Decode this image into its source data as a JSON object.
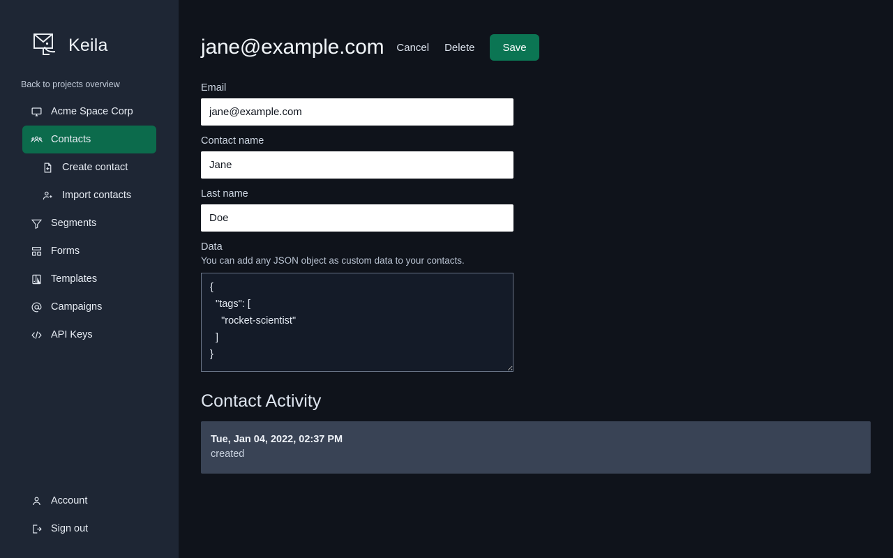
{
  "brand": {
    "name": "Keila",
    "logo_icon": "envelope-rocket-logo"
  },
  "sidebar": {
    "back_link": "Back to projects overview",
    "items": [
      {
        "label": "Acme Space Corp",
        "icon": "monitor-icon",
        "active": false,
        "sub": false
      },
      {
        "label": "Contacts",
        "icon": "users-group-icon",
        "active": true,
        "sub": false
      },
      {
        "label": "Create contact",
        "icon": "document-plus-icon",
        "active": false,
        "sub": true
      },
      {
        "label": "Import contacts",
        "icon": "user-plus-icon",
        "active": false,
        "sub": true
      },
      {
        "label": "Segments",
        "icon": "funnel-icon",
        "active": false,
        "sub": false
      },
      {
        "label": "Forms",
        "icon": "layout-rows-icon",
        "active": false,
        "sub": false
      },
      {
        "label": "Templates",
        "icon": "template-document-icon",
        "active": false,
        "sub": false
      },
      {
        "label": "Campaigns",
        "icon": "at-sign-icon",
        "active": false,
        "sub": false
      },
      {
        "label": "API Keys",
        "icon": "code-brackets-icon",
        "active": false,
        "sub": false
      }
    ],
    "bottom_items": [
      {
        "label": "Account",
        "icon": "user-icon"
      },
      {
        "label": "Sign out",
        "icon": "sign-out-icon"
      }
    ]
  },
  "header": {
    "title": "jane@example.com",
    "cancel_label": "Cancel",
    "delete_label": "Delete",
    "save_label": "Save"
  },
  "form": {
    "email": {
      "label": "Email",
      "value": "jane@example.com",
      "placeholder": "Email"
    },
    "contact_name": {
      "label": "Contact name",
      "value": "Jane",
      "placeholder": "Contact name"
    },
    "last_name": {
      "label": "Last name",
      "value": "Doe",
      "placeholder": "Last name"
    },
    "data": {
      "label": "Data",
      "help": "You can add any JSON object as custom data to your contacts.",
      "value": "{\n  \"tags\": [\n    \"rocket-scientist\"\n  ]\n}",
      "placeholder": "{}"
    }
  },
  "activity": {
    "section_title": "Contact Activity",
    "entries": [
      {
        "date": "Tue, Jan 04, 2022, 02:37 PM",
        "type": "created"
      }
    ]
  },
  "colors": {
    "sidebar_bg": "#1e2634",
    "main_bg": "#0f131b",
    "accent_green": "#0c6b4c",
    "save_green": "#0b7553",
    "activity_card": "#394355"
  }
}
